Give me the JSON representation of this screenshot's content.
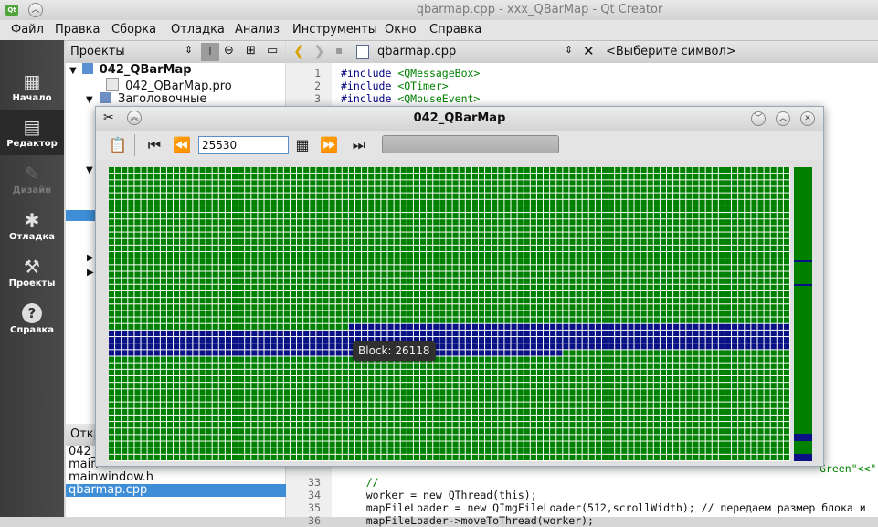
{
  "window": {
    "title": "qbarmap.cpp - xxx_QBarMap - Qt Creator",
    "logo": "Qt"
  },
  "menu": [
    "Файл",
    "Правка",
    "Сборка",
    "Отладка",
    "Анализ",
    "Инструменты",
    "Окно",
    "Справка"
  ],
  "modes": [
    {
      "label": "Начало",
      "icon": "grid-icon"
    },
    {
      "label": "Редактор",
      "icon": "editor-icon"
    },
    {
      "label": "Дизайн",
      "icon": "design-icon"
    },
    {
      "label": "Отладка",
      "icon": "bug-icon"
    },
    {
      "label": "Проекты",
      "icon": "wrench-icon"
    },
    {
      "label": "Справка",
      "icon": "help-icon"
    }
  ],
  "projects": {
    "header": "Проекты",
    "tree": [
      "042_QBarMap",
      "042_QBarMap.pro",
      "Заголовочные"
    ]
  },
  "open_docs": {
    "header": "Откр",
    "items": [
      "042_",
      "main",
      "mainwindow.h",
      "qbarmap.cpp"
    ]
  },
  "editor": {
    "file": "qbarmap.cpp",
    "symbol_placeholder": "<Выберите символ>",
    "lines_top": [
      {
        "n": "1",
        "kw": "#include",
        "arg": "<QMessageBox>"
      },
      {
        "n": "2",
        "kw": "#include",
        "arg": "<QTimer>"
      },
      {
        "n": "3",
        "kw": "#include",
        "arg": "<QMouseEvent>"
      }
    ],
    "line_partial_tail": "Green\"<<\"",
    "lines_bottom": [
      {
        "n": "33",
        "text": "    //"
      },
      {
        "n": "34",
        "text": "    worker = new QThread(this);"
      },
      {
        "n": "35",
        "text": "    mapFileLoader = new QImgFileLoader(512,scrollWidth); // передаем размер блока и"
      },
      {
        "n": "36",
        "text": "    mapFileLoader->moveToThread(worker);"
      }
    ]
  },
  "dialog": {
    "title": "042_QBarMap",
    "block_input": "25530",
    "tooltip": "Block: 26118",
    "progress_fraction": 0,
    "map": {
      "columns": 105,
      "rows": 45,
      "colors": {
        "used": "#008000",
        "selected": "#0a1185",
        "border": "#ffffff"
      },
      "selected_from_row": 24,
      "selected_from_col": 37,
      "selected_to_row": 28,
      "selected_to_col": 70
    }
  }
}
